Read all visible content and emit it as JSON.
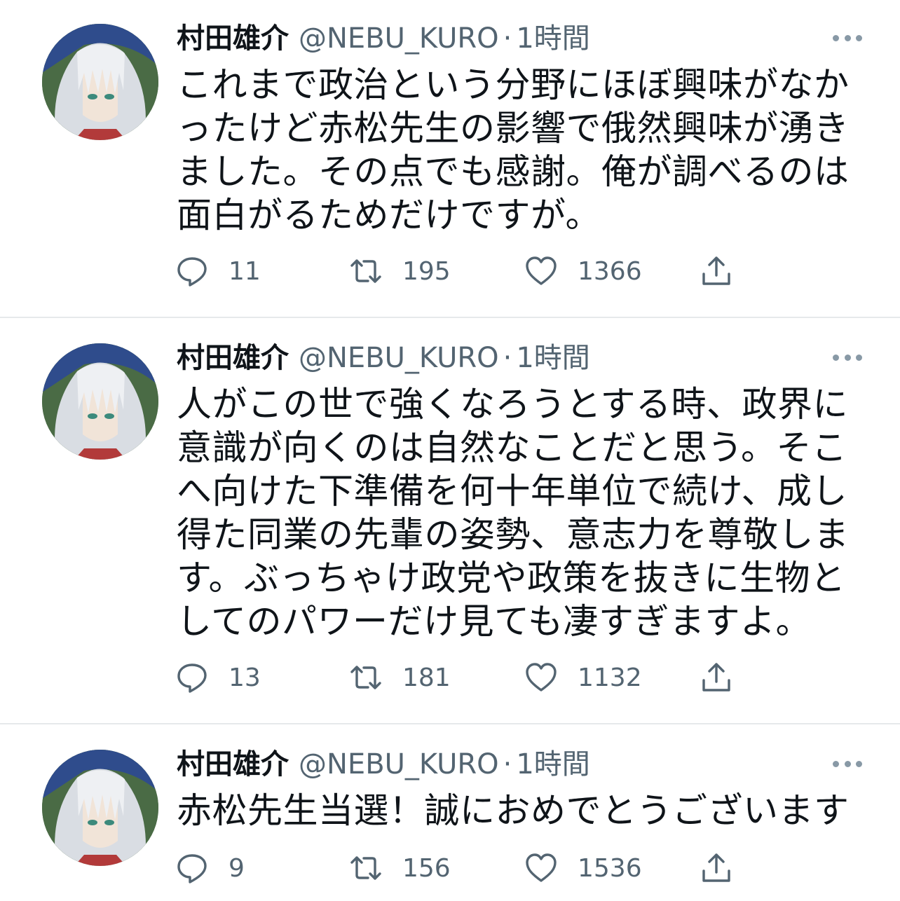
{
  "tweets": [
    {
      "author_name": "村田雄介",
      "handle": "@NEBU_KURO",
      "separator": "·",
      "time": "1時間",
      "text": "これまで政治という分野にほぼ興味がなかったけど赤松先生の影響で俄然興味が湧きました。その点でも感謝。俺が調べるのは面白がるためだけですが。",
      "replies": "11",
      "retweets": "195",
      "likes": "1366"
    },
    {
      "author_name": "村田雄介",
      "handle": "@NEBU_KURO",
      "separator": "·",
      "time": "1時間",
      "text": "人がこの世で強くなろうとする時、政界に意識が向くのは自然なことだと思う。そこへ向けた下準備を何十年単位で続け、成し得た同業の先輩の姿勢、意志力を尊敬します。ぶっちゃけ政党や政策を抜きに生物としてのパワーだけ見ても凄すぎますよ。",
      "replies": "13",
      "retweets": "181",
      "likes": "1132"
    },
    {
      "author_name": "村田雄介",
      "handle": "@NEBU_KURO",
      "separator": "·",
      "time": "1時間",
      "text": "赤松先生当選！誠におめでとうございます",
      "replies": "9",
      "retweets": "156",
      "likes": "1536"
    }
  ],
  "icons": {
    "reply": "reply-icon",
    "retweet": "retweet-icon",
    "like": "heart-icon",
    "share": "share-icon",
    "more": "more-icon"
  },
  "colors": {
    "text": "#0f1419",
    "secondary": "#536471",
    "divider": "#e6e9eb"
  }
}
